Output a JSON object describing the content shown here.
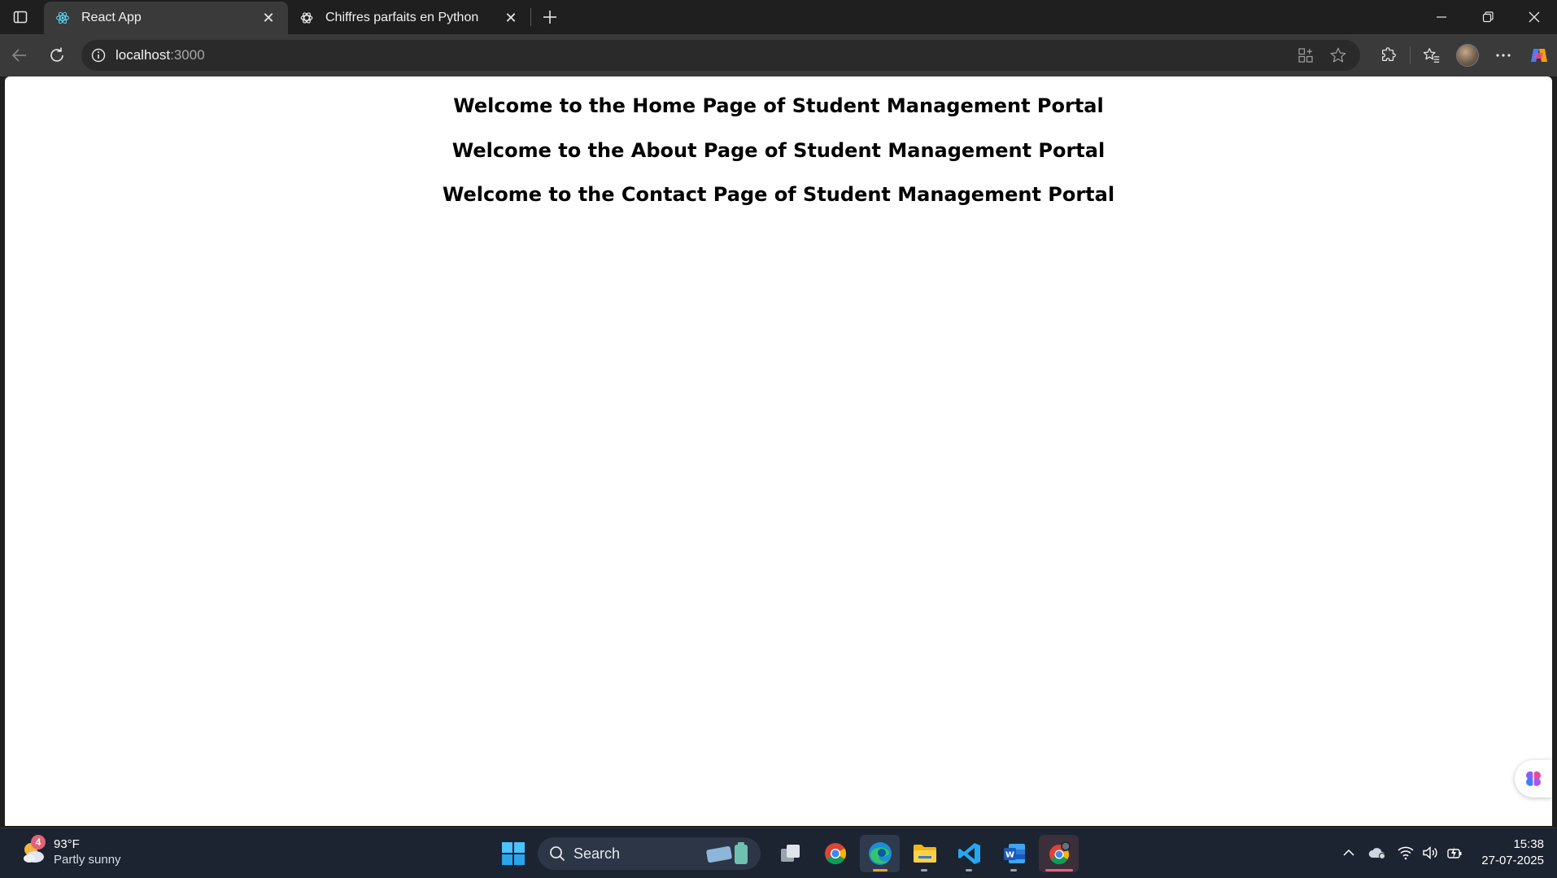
{
  "browser": {
    "tabs": [
      {
        "title": "React App",
        "favicon": "react-icon",
        "active": true
      },
      {
        "title": "Chiffres parfaits en Python",
        "favicon": "openai-icon",
        "active": false
      }
    ],
    "address": {
      "host": "localhost",
      "port": ":3000"
    }
  },
  "page": {
    "headings": [
      "Welcome to the Home Page of Student Management Portal",
      "Welcome to the About Page of Student Management Portal",
      "Welcome to the Contact Page of Student Management Portal"
    ]
  },
  "taskbar": {
    "weather": {
      "temp": "93°F",
      "condition": "Partly sunny",
      "badge": "4"
    },
    "search_label": "Search",
    "clock": {
      "time": "15:38",
      "date": "27-07-2025"
    }
  },
  "colors": {
    "tab_active": "#3a3a3a",
    "chrome_bg": "#1f1f1f",
    "page_bg": "#ffffff",
    "taskbar_bg": "#1c2431"
  }
}
